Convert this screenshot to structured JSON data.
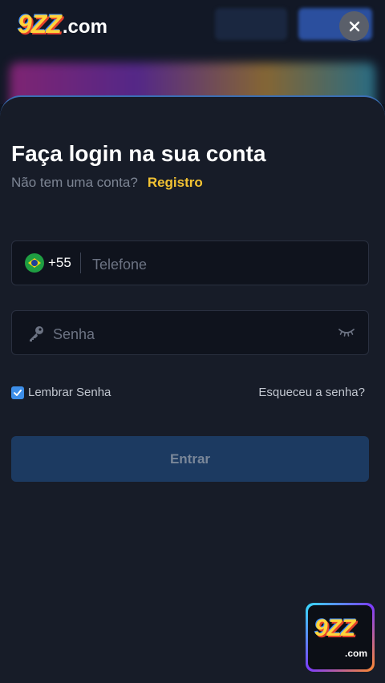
{
  "header": {
    "logo_main": "9ZZ",
    "logo_suffix": ".com",
    "close_label": "×"
  },
  "login": {
    "title": "Faça login na sua conta",
    "no_account_text": "Não tem uma conta?",
    "register_link": "Registro",
    "phone": {
      "country_code": "+55",
      "placeholder": "Telefone",
      "value": "",
      "flag_icon": "brazil-flag-icon"
    },
    "password": {
      "placeholder": "Senha",
      "value": "",
      "key_icon": "key-icon",
      "toggle_icon": "eye-closed-icon"
    },
    "remember_label": "Lembrar Senha",
    "remember_checked": true,
    "forgot_link": "Esqueceu a senha?",
    "submit_label": "Entrar"
  },
  "floating_app": {
    "logo_main": "9ZZ",
    "logo_suffix": ".com"
  },
  "colors": {
    "accent_yellow": "#f2c233",
    "checkbox_blue": "#3d8ee8",
    "submit_bg": "#1c3a61",
    "sheet_bg": "#171c28"
  }
}
